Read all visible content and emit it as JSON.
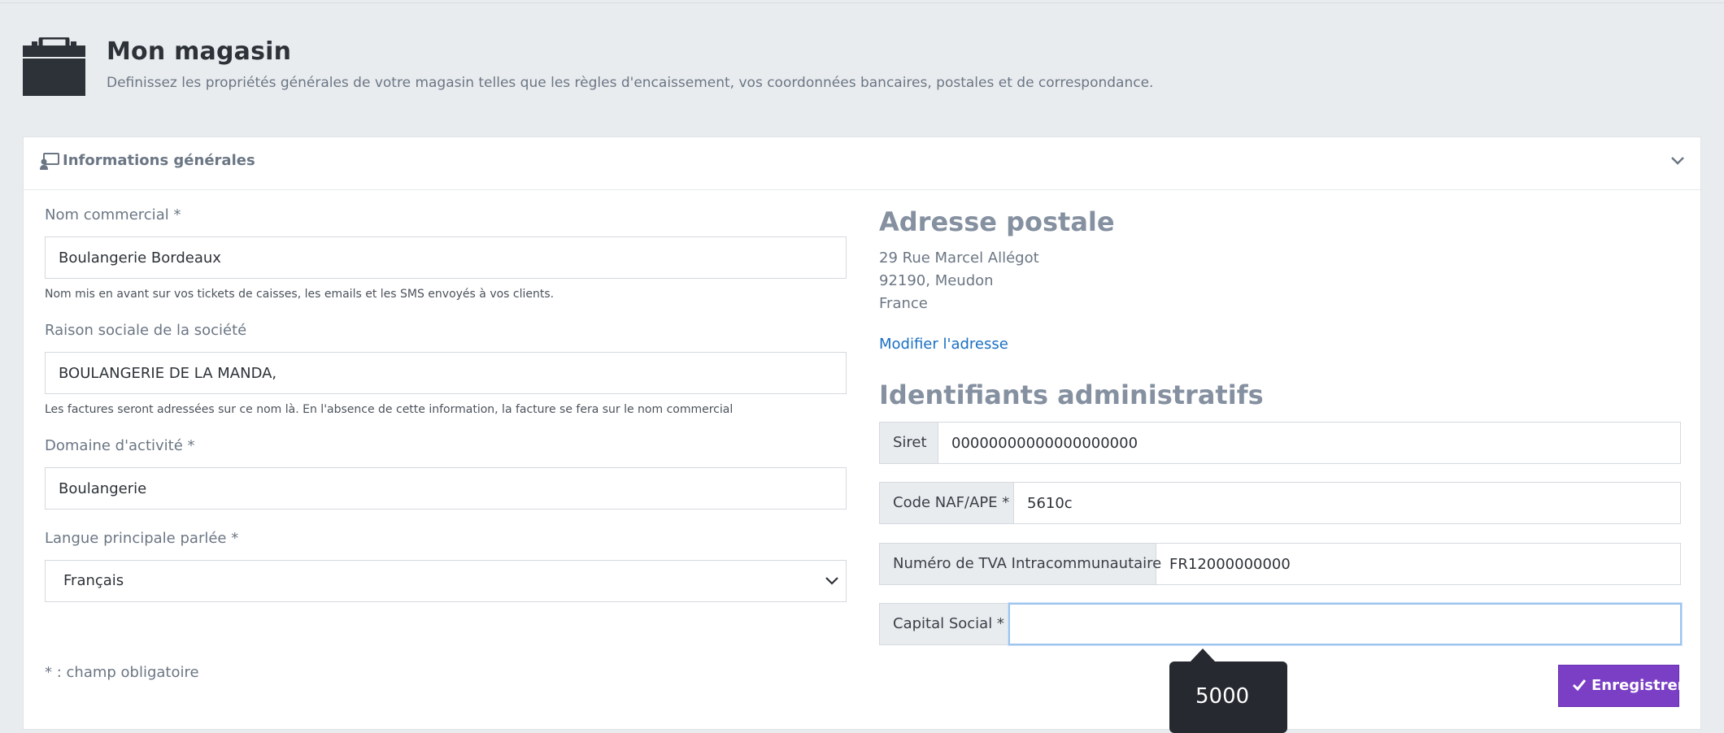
{
  "page": {
    "title": "Mon magasin",
    "subtitle": "Definissez les propriétés générales de votre magasin telles que les règles d'encaissement, vos coordonnées bancaires, postales et de correspondance."
  },
  "panel": {
    "title": "Informations générales"
  },
  "form": {
    "commercial_name": {
      "label": "Nom commercial *",
      "value": "Boulangerie Bordeaux",
      "help": "Nom mis en avant sur vos tickets de caisses, les emails et les SMS envoyés à vos clients."
    },
    "company_name": {
      "label": "Raison sociale de la société",
      "value": "BOULANGERIE DE LA MANDA,",
      "help": "Les factures seront adressées sur ce nom là. En l'absence de cette information, la facture se fera sur le nom commercial"
    },
    "activity": {
      "label": "Domaine d'activité *",
      "value": "Boulangerie"
    },
    "language": {
      "label": "Langue principale parlée *",
      "selected": "Français"
    },
    "required_note": "* : champ obligatoire"
  },
  "address": {
    "title": "Adresse postale",
    "line1": "29 Rue Marcel Allégot",
    "line2": "92190, Meudon",
    "line3": "France",
    "edit_link": "Modifier l'adresse"
  },
  "admin": {
    "title": "Identifiants administratifs",
    "siret": {
      "label": "Siret",
      "value": "00000000000000000000"
    },
    "naf": {
      "label": "Code NAF/APE *",
      "value": "5610c"
    },
    "tva": {
      "label": "Numéro de TVA Intracommunautaire",
      "value": "FR12000000000"
    },
    "capital": {
      "label": "Capital Social *",
      "value": ""
    }
  },
  "tooltip": {
    "text": "5000"
  },
  "buttons": {
    "save": "Enregistrer"
  },
  "colors": {
    "accent": "#7a3fc4",
    "link": "#1a6fc4",
    "focus": "#9cc4ef"
  },
  "icons": [
    "briefcase-icon",
    "monitor-user-icon",
    "chevron-down-icon",
    "check-icon"
  ]
}
